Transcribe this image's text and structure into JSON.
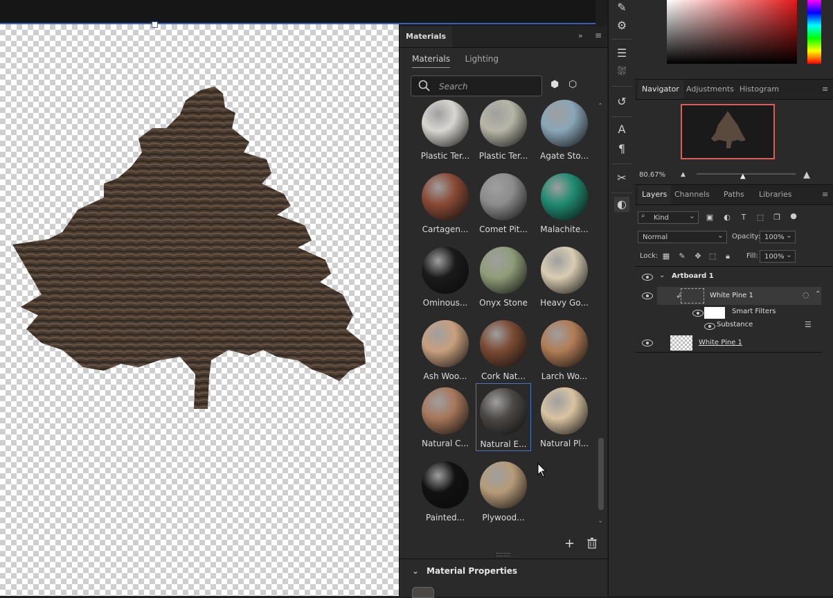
{
  "materials_panel": {
    "title": "Materials",
    "tabs": [
      "Materials",
      "Lighting"
    ],
    "search_placeholder": "Search",
    "items": [
      {
        "label": "Plastic Ter...",
        "color": "#d8d6d0"
      },
      {
        "label": "Plastic Ter...",
        "color": "#b7b6a7"
      },
      {
        "label": "Agate Sto...",
        "color": "#8aa6b8"
      },
      {
        "label": "Cartagen...",
        "color": "#8a4a35"
      },
      {
        "label": "Comet Pit...",
        "color": "#8c8c8c"
      },
      {
        "label": "Malachite...",
        "color": "#1f8a70"
      },
      {
        "label": "Ominous...",
        "color": "#1a1a1a"
      },
      {
        "label": "Onyx Stone",
        "color": "#8f9d79"
      },
      {
        "label": "Heavy Go...",
        "color": "#d8ccb2"
      },
      {
        "label": "Ash Woo...",
        "color": "#c89f7e"
      },
      {
        "label": "Cork Nat...",
        "color": "#7a4a33"
      },
      {
        "label": "Larch Wo...",
        "color": "#b07c55"
      },
      {
        "label": "Natural C...",
        "color": "#a7775a"
      },
      {
        "label": "Natural E...",
        "color": "#4b4744",
        "selected": true
      },
      {
        "label": "Natural Pl...",
        "color": "#d9c3a0"
      },
      {
        "label": "Painted...",
        "color": "#111111"
      },
      {
        "label": "Plywood...",
        "color": "#b79b78"
      }
    ],
    "footer": {
      "add_icon": "plus-icon",
      "delete_icon": "trash-icon"
    },
    "properties_title": "Material Properties"
  },
  "navigator": {
    "tabs": [
      "Navigator",
      "Adjustments",
      "Histogram"
    ],
    "zoom": "80.67%"
  },
  "layers": {
    "tabs": [
      "Layers",
      "Channels",
      "Paths",
      "Libraries"
    ],
    "kind_label": "Kind",
    "blend_mode": "Normal",
    "opacity_label": "Opacity:",
    "opacity_value": "100%",
    "lock_label": "Lock:",
    "fill_label": "Fill:",
    "fill_value": "100%",
    "rows": {
      "artboard": "Artboard 1",
      "smart_object": "White Pine 1",
      "smart_filters": "Smart Filters",
      "filter": "Substance",
      "base_layer": "White Pine 1"
    }
  },
  "colors": {
    "accent": "#4a78c9",
    "nav_frame": "#e35b5b"
  }
}
